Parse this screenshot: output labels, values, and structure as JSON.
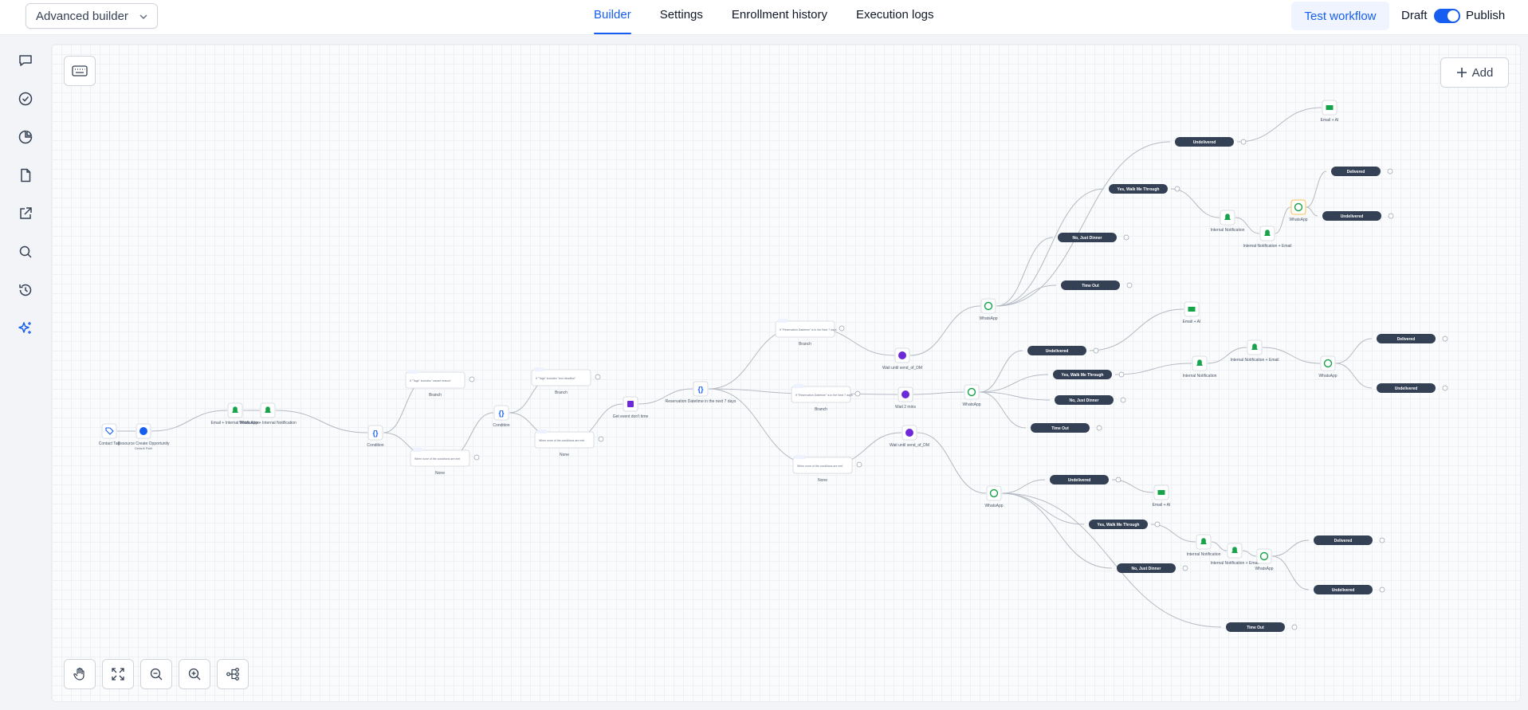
{
  "header": {
    "mode_select": "Advanced builder",
    "tabs": [
      {
        "label": "Builder",
        "active": true
      },
      {
        "label": "Settings",
        "active": false
      },
      {
        "label": "Enrollment history",
        "active": false
      },
      {
        "label": "Execution logs",
        "active": false
      }
    ],
    "test_workflow": "Test workflow",
    "draft_label": "Draft",
    "publish_label": "Publish",
    "publish_toggle_on": true
  },
  "sidebar": {
    "items": [
      {
        "icon": "chat-icon"
      },
      {
        "icon": "check-circle-icon"
      },
      {
        "icon": "pie-chart-icon"
      },
      {
        "icon": "document-icon"
      },
      {
        "icon": "external-link-icon"
      },
      {
        "icon": "search-icon"
      },
      {
        "icon": "history-icon"
      },
      {
        "icon": "sparkles-icon",
        "active": true
      }
    ]
  },
  "canvas": {
    "add_label": "Add",
    "toolbar_icons": [
      "hand-icon",
      "fit-screen-icon",
      "zoom-out-icon",
      "zoom-in-icon",
      "auto-layout-icon"
    ]
  },
  "colors": {
    "accent": "#155eef",
    "pill_dark": "#344054",
    "node_green": "#16a34a",
    "node_purple": "#6d28d9"
  },
  "workflow": {
    "nodes": [
      {
        "label": "Contact Tag",
        "sub": ""
      },
      {
        "label": "Resource Create Opportunity",
        "sub": "Default Path"
      },
      {
        "label": "Email + Internal Notification",
        "sub": ""
      },
      {
        "label": "WhatsApp + Internal Notification",
        "sub": ""
      },
      {
        "label": "Condition",
        "sub": ""
      },
      {
        "label": "Branch",
        "sub": "If \"Tags\" includes \"vacant reason\""
      },
      {
        "label": "None",
        "sub": "When none of the conditions are met"
      },
      {
        "label": "Condition",
        "sub": ""
      },
      {
        "label": "Branch",
        "sub": "If \"Tags\" includes \"tour deadline\""
      },
      {
        "label": "None",
        "sub": "When none of the conditions are met"
      },
      {
        "label": "Get event don't time",
        "sub": ""
      },
      {
        "label": "Reservation Datetime in the next 7 days",
        "sub": ""
      },
      {
        "label": "Branch",
        "sub": "If \"Reservation Datetime\" is in the Next 7 days"
      },
      {
        "label": "Branch",
        "sub": "If \"Reservation Datetime\" is in the Next 7 days"
      },
      {
        "label": "None",
        "sub": "When none of the conditions are met"
      },
      {
        "label": "Wait until send_of_DM",
        "sub": ""
      },
      {
        "label": "Wait 2 mins",
        "sub": ""
      },
      {
        "label": "Wait until send_of_DM",
        "sub": ""
      },
      {
        "label": "WhatsApp",
        "sub": ""
      },
      {
        "label": "WhatsApp",
        "sub": ""
      },
      {
        "label": "WhatsApp",
        "sub": ""
      },
      {
        "label": "Email + AI",
        "sub": ""
      },
      {
        "label": "Internal Notification",
        "sub": ""
      },
      {
        "label": "Internal Notification + Email",
        "sub": ""
      },
      {
        "label": "WhatsApp",
        "sub": ""
      },
      {
        "label": "Email + AI",
        "sub": ""
      },
      {
        "label": "Internal Notification",
        "sub": ""
      },
      {
        "label": "Internal Notification + Email",
        "sub": ""
      },
      {
        "label": "WhatsApp",
        "sub": ""
      },
      {
        "label": "Email + AI",
        "sub": ""
      },
      {
        "label": "Internal Notification",
        "sub": ""
      },
      {
        "label": "Internal Notification + Email",
        "sub": ""
      },
      {
        "label": "WhatsApp",
        "sub": ""
      }
    ],
    "pills": [
      "Undelivered",
      "Yes, Walk Me Through",
      "No, Just Dinner",
      "Time Out",
      "Delivered",
      "Undelivered",
      "Undelivered",
      "Yes, Walk Me Through",
      "No, Just Dinner",
      "Time Out",
      "Delivered",
      "Undelivered",
      "Undelivered",
      "Yes, Walk Me Through",
      "No, Just Dinner",
      "Time Out",
      "Delivered",
      "Undelivered"
    ]
  }
}
